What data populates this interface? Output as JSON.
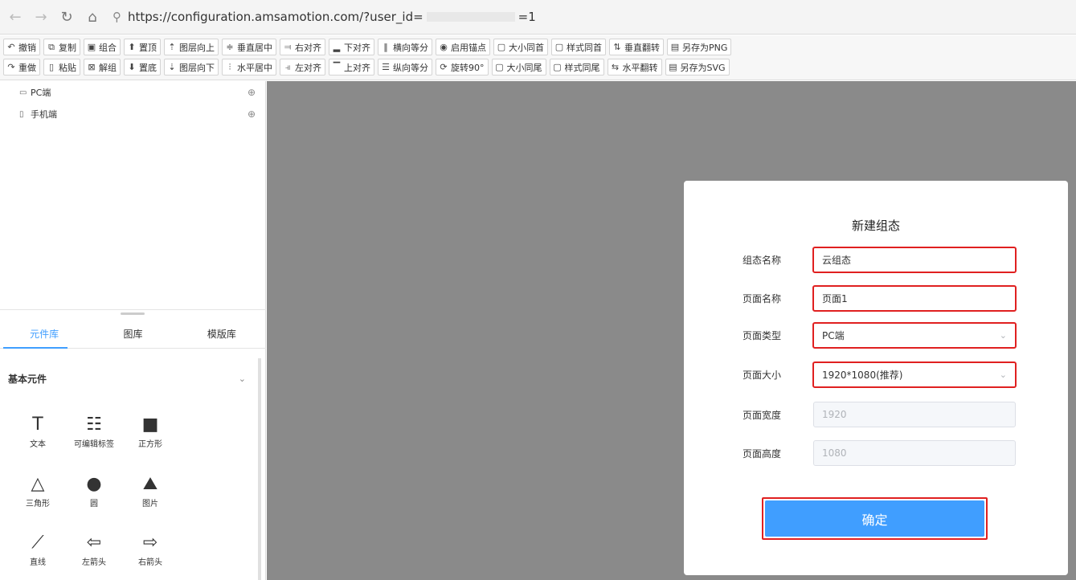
{
  "browser": {
    "url_prefix": "https://configuration.amsamotion.com/?user_id=",
    "url_suffix": "=1"
  },
  "toolbar": {
    "row1": [
      {
        "icon": "↶",
        "label": "撤销"
      },
      {
        "icon": "⧉",
        "label": "复制"
      },
      {
        "icon": "▣",
        "label": "组合"
      },
      {
        "icon": "⬆",
        "label": "置顶"
      },
      {
        "icon": "⇡",
        "label": "图层向上"
      },
      {
        "icon": "≑",
        "label": "垂直居中"
      },
      {
        "icon": "⫤",
        "label": "右对齐"
      },
      {
        "icon": "▂",
        "label": "下对齐"
      },
      {
        "icon": "‖",
        "label": "横向等分"
      },
      {
        "icon": "◉",
        "label": "启用锚点"
      },
      {
        "icon": "▢",
        "label": "大小同首"
      },
      {
        "icon": "▢",
        "label": "样式同首"
      },
      {
        "icon": "⇅",
        "label": "垂直翻转"
      },
      {
        "icon": "▤",
        "label": "另存为PNG"
      }
    ],
    "row2": [
      {
        "icon": "↷",
        "label": "重做"
      },
      {
        "icon": "▯",
        "label": "粘贴"
      },
      {
        "icon": "⊠",
        "label": "解组"
      },
      {
        "icon": "⬇",
        "label": "置底"
      },
      {
        "icon": "⇣",
        "label": "图层向下"
      },
      {
        "icon": "⫶",
        "label": "水平居中"
      },
      {
        "icon": "⫣",
        "label": "左对齐"
      },
      {
        "icon": "▔",
        "label": "上对齐"
      },
      {
        "icon": "☰",
        "label": "纵向等分"
      },
      {
        "icon": "⟳",
        "label": "旋转90°"
      },
      {
        "icon": "▢",
        "label": "大小同尾"
      },
      {
        "icon": "▢",
        "label": "样式同尾"
      },
      {
        "icon": "⇆",
        "label": "水平翻转"
      },
      {
        "icon": "▤",
        "label": "另存为SVG"
      }
    ]
  },
  "tree": {
    "pc": "PC端",
    "mobile": "手机端"
  },
  "tabs": [
    "元件库",
    "图库",
    "模版库"
  ],
  "section": {
    "title": "基本元件"
  },
  "components": [
    {
      "icon": "T",
      "label": "文本"
    },
    {
      "icon": "☷",
      "label": "可编辑标签"
    },
    {
      "icon": "■",
      "label": "正方形"
    },
    {
      "icon": "△",
      "label": "三角形"
    },
    {
      "icon": "●",
      "label": "圆"
    },
    {
      "icon": "⛰",
      "label": "图片"
    },
    {
      "icon": "⟋",
      "label": "直线"
    },
    {
      "icon": "⇦",
      "label": "左箭头"
    },
    {
      "icon": "⇨",
      "label": "右箭头"
    }
  ],
  "dialog": {
    "title": "新建组态",
    "fields": {
      "config_name": {
        "label": "组态名称",
        "value": "云组态"
      },
      "page_name": {
        "label": "页面名称",
        "value": "页面1"
      },
      "page_type": {
        "label": "页面类型",
        "value": "PC端"
      },
      "page_size": {
        "label": "页面大小",
        "value": "1920*1080(推荐)"
      },
      "page_width": {
        "label": "页面宽度",
        "value": "1920"
      },
      "page_height": {
        "label": "页面高度",
        "value": "1080"
      }
    },
    "confirm": "确定"
  },
  "colors": {
    "accent": "#409eff",
    "highlight": "#e02020",
    "canvas_bg": "#8a8a8a"
  }
}
